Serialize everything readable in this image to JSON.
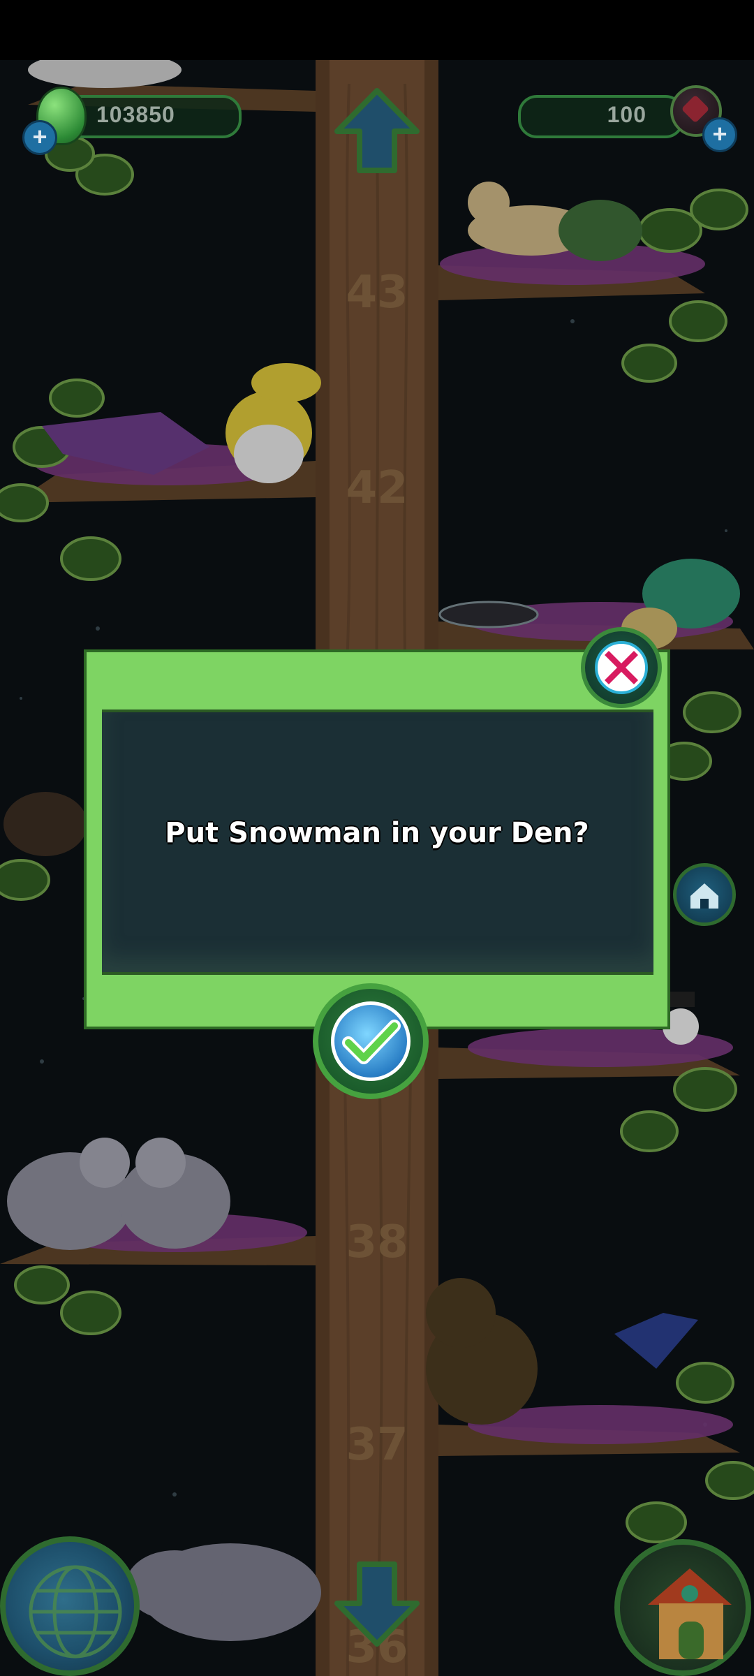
{
  "currency": {
    "eggs": "103850",
    "gems": "100"
  },
  "tree": {
    "branch_numbers": [
      "43",
      "42",
      "38",
      "37",
      "36"
    ]
  },
  "dialog": {
    "message": "Put Snowman in your Den?"
  },
  "icons": {
    "egg": "green-egg-icon",
    "gem": "red-gem-icon",
    "add": "plus-icon",
    "close": "close-x-icon",
    "confirm": "checkmark-icon",
    "up": "up-arrow-icon",
    "down": "down-arrow-icon",
    "globe": "globe-icon",
    "home": "house-icon",
    "den": "den-icon"
  },
  "colors": {
    "dialog_green": "#7ed463",
    "dialog_panel": "#1b2f35",
    "trunk": "#6f4e32",
    "leaf": "#2f5a22",
    "close_red": "#d81b60",
    "confirm_blue": "#2a7fc6",
    "check_green": "#5fd24a"
  }
}
